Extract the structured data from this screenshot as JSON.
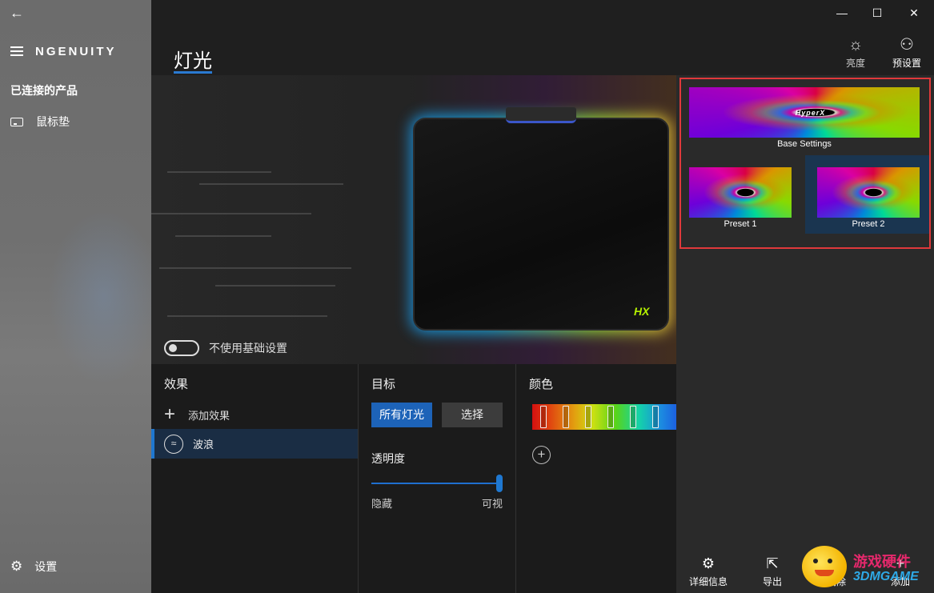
{
  "window": {
    "back": "←",
    "minimize": "—",
    "maximize": "☐",
    "close": "✕"
  },
  "sidebar": {
    "brand": "NGENUITY",
    "section_title": "已连接的产品",
    "device_label": "鼠标垫",
    "settings_label": "设置"
  },
  "header": {
    "title": "灯光",
    "brightness_label": "亮度",
    "presets_label": "预设置"
  },
  "preview": {
    "toggle_label": "不使用基础设置",
    "mat_logo": "HX"
  },
  "effects": {
    "title": "效果",
    "add_label": "添加效果",
    "items": [
      {
        "label": "波浪"
      }
    ]
  },
  "target": {
    "title": "目标",
    "all_lights": "所有灯光",
    "select": "选择",
    "opacity_title": "透明度",
    "opacity_min": "隐藏",
    "opacity_max": "可视",
    "opacity_value": 1.0
  },
  "color": {
    "title": "颜色",
    "add_symbol": "+"
  },
  "presets": {
    "thumb_text": "HyperX",
    "items": [
      {
        "label": "Base Settings"
      },
      {
        "label": "Preset 1"
      },
      {
        "label": "Preset 2"
      }
    ]
  },
  "bottom_actions": {
    "details": "详细信息",
    "export": "导出",
    "delete_partial": "删除",
    "add": "添加"
  },
  "watermark": {
    "line1": "游戏硬件",
    "line2": "3DMGAME"
  },
  "colors": {
    "accent": "#1f78d1",
    "highlight_box": "#e0393b",
    "selected_row": "#1a2d44"
  }
}
